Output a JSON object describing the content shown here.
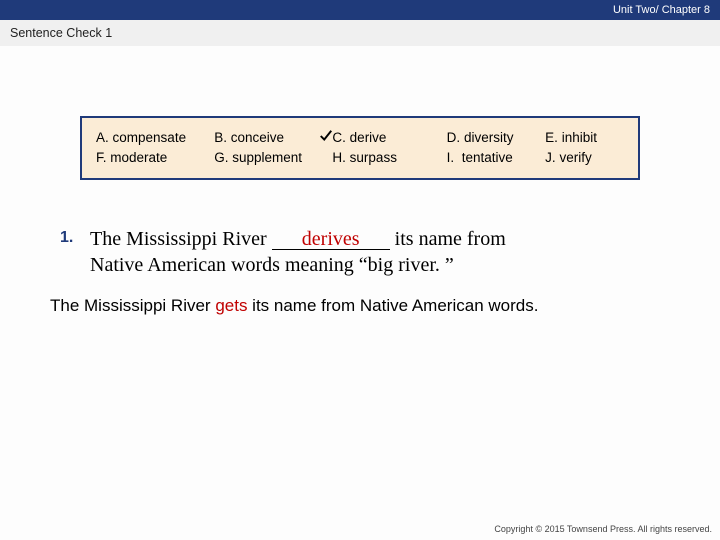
{
  "header": {
    "unit_chapter": "Unit Two/ Chapter 8",
    "subtitle": "Sentence Check 1"
  },
  "choices": {
    "row1": {
      "a": {
        "letter": "A.",
        "word": "compensate"
      },
      "b": {
        "letter": "B.",
        "word": "conceive"
      },
      "c": {
        "letter": "C.",
        "word": "derive",
        "checked": true
      },
      "d": {
        "letter": "D.",
        "word": "diversity"
      },
      "e": {
        "letter": "E.",
        "word": "inhibit"
      }
    },
    "row2": {
      "a": {
        "letter": "F.",
        "word": "moderate"
      },
      "b": {
        "letter": "G.",
        "word": "supplement"
      },
      "c": {
        "letter": "H.",
        "word": "surpass"
      },
      "d": {
        "letter": "I.",
        "word": "tentative"
      },
      "e": {
        "letter": "J.",
        "word": "verify"
      }
    }
  },
  "question": {
    "number": "1.",
    "pre": "The Mississippi River ",
    "answer": "derives",
    "post1": " its name from",
    "line2": "Native American words meaning “big river. ”"
  },
  "explanation": {
    "pre": "The Mississippi River ",
    "highlight": "gets",
    "post": " its name from Native American words."
  },
  "footer": {
    "copyright": "Copyright © 2015 Townsend Press. All rights reserved."
  }
}
